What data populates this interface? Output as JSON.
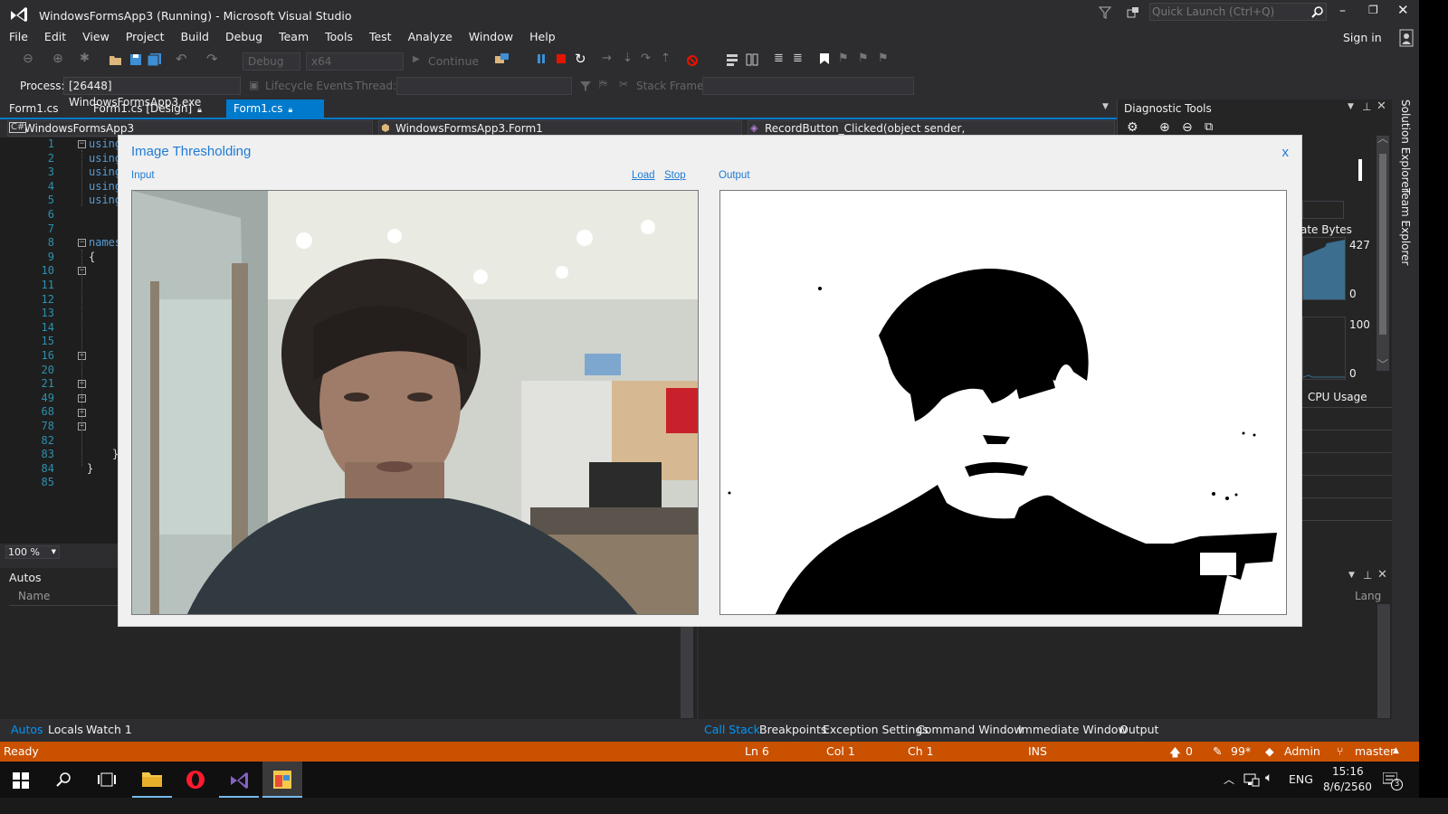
{
  "window": {
    "title": "WindowsFormsApp3 (Running) - Microsoft Visual Studio",
    "quick_launch_placeholder": "Quick Launch (Ctrl+Q)",
    "sign_in": "Sign in"
  },
  "menu": [
    "File",
    "Edit",
    "View",
    "Project",
    "Build",
    "Debug",
    "Team",
    "Tools",
    "Test",
    "Analyze",
    "Window",
    "Help"
  ],
  "toolbar": {
    "config": "Debug",
    "platform": "x64",
    "continue": "Continue"
  },
  "process_bar": {
    "process_label": "Process:",
    "process_value": "[26448] WindowsFormsApp3.exe",
    "lifecycle": "Lifecycle Events",
    "thread_label": "Thread:",
    "stack_frame_label": "Stack Frame:"
  },
  "tabs": [
    "Form1.cs",
    "Form1.cs [Design]",
    "Form1.cs"
  ],
  "navbar": {
    "project": "WindowsFormsApp3",
    "class": "WindowsFormsApp3.Form1",
    "member": "RecordButton_Clicked(object sender, LinkLabelLinkClickedEventArgs e)"
  },
  "editor": {
    "line_numbers": [
      "1",
      "2",
      "3",
      "4",
      "5",
      "6",
      "7",
      "8",
      "9",
      "10",
      "11",
      "12",
      "13",
      "14",
      "15",
      "16",
      "20",
      "21",
      "49",
      "68",
      "78",
      "82",
      "83",
      "84",
      "85"
    ],
    "using_kw": "using",
    "namespace_kw": "names",
    "brace_open": "{",
    "brace_close": "}",
    "zoom": "100 %"
  },
  "diagnostic": {
    "title": "Diagnostic Tools",
    "private_bytes": "ate Bytes",
    "mem_max": "427",
    "mem_min": "0",
    "cpu_max": "100",
    "cpu_min": "0",
    "cpu_label": "CPU Usage"
  },
  "side_tabs": {
    "solution_explorer": "Solution Explorer",
    "team_explorer": "Team Explorer"
  },
  "autos": {
    "title": "Autos",
    "col_name": "Name"
  },
  "callstack": {
    "col_lang": "Lang"
  },
  "bottom_tabs_left": [
    "Autos",
    "Locals",
    "Watch 1"
  ],
  "bottom_tabs_right": [
    "Call Stack",
    "Breakpoints",
    "Exception Settings",
    "Command Window",
    "Immediate Window",
    "Output"
  ],
  "status": {
    "ready": "Ready",
    "ln": "Ln 6",
    "col": "Col 1",
    "ch": "Ch 1",
    "ins": "INS",
    "up_count": "0",
    "pencil_count": "99*",
    "repo": "Admin",
    "branch": "master"
  },
  "taskbar": {
    "lang": "ENG",
    "time": "15:16",
    "date": "8/6/2560",
    "notifications": "3"
  },
  "dialog": {
    "title": "Image Thresholding",
    "close": "x",
    "input_label": "Input",
    "load_link": "Load",
    "stop_link": "Stop",
    "output_label": "Output"
  },
  "colors": {
    "vs_bg": "#2d2d30",
    "accent": "#007acc",
    "status": "#ca5100",
    "dialog_text": "#1e7ad6"
  }
}
